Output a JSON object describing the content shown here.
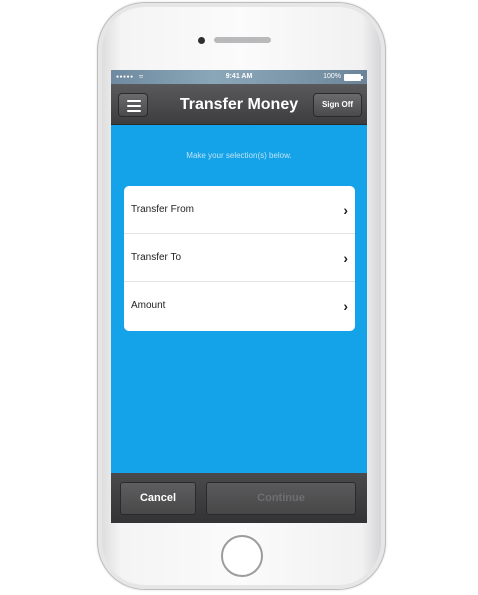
{
  "status_bar": {
    "signal": "●●●●●",
    "time": "9:41 AM",
    "battery": "100%"
  },
  "navbar": {
    "title": "Transfer Money",
    "sign_off_label": "Sign Off"
  },
  "main": {
    "instruction": "Make your selection(s) below.",
    "items": [
      {
        "label": "Transfer From"
      },
      {
        "label": "Transfer To"
      },
      {
        "label": "Amount"
      }
    ]
  },
  "footer": {
    "cancel_label": "Cancel",
    "continue_label": "Continue"
  },
  "colors": {
    "background_blue": "#14a3e8",
    "bar_dark": "#3d3d3f"
  },
  "icons": {
    "menu": "hamburger-menu-icon",
    "chevron": "chevron-right-icon",
    "wifi": "wifi-icon",
    "battery": "battery-icon"
  }
}
